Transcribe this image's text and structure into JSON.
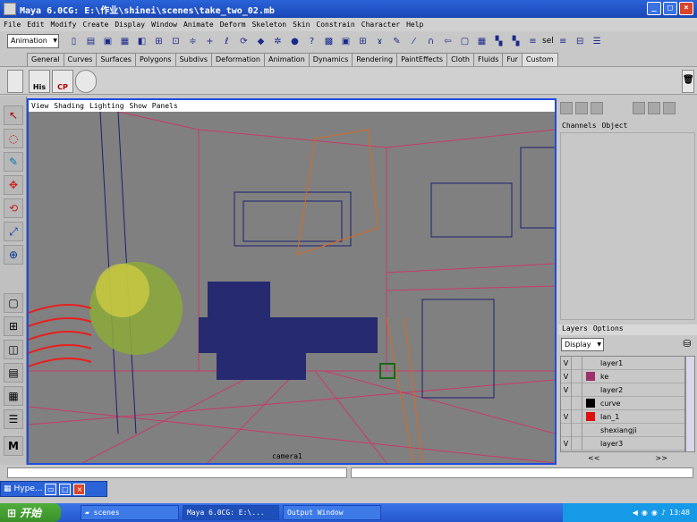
{
  "window": {
    "title": "Maya 6.0CG: E:\\作业\\shinei\\scenes\\take_two_02.mb",
    "controls": [
      "_",
      "□",
      "×"
    ]
  },
  "menubar": [
    "File",
    "Edit",
    "Modify",
    "Create",
    "Display",
    "Window",
    "Animate",
    "Deform",
    "Skeleton",
    "Skin",
    "Constrain",
    "Character",
    "Help"
  ],
  "toolbar": {
    "mode": "Animation",
    "sel_label": "sel"
  },
  "shelf": {
    "tabs": [
      "General",
      "Curves",
      "Surfaces",
      "Polygons",
      "Subdivs",
      "Deformation",
      "Animation",
      "Dynamics",
      "Rendering",
      "PaintEffects",
      "Cloth",
      "Fluids",
      "Fur",
      "Custom"
    ],
    "active": "Custom",
    "buttons": [
      "His",
      "CP"
    ]
  },
  "viewport": {
    "menu": [
      "View",
      "Shading",
      "Lighting",
      "Show",
      "Panels"
    ],
    "camera": "camera1"
  },
  "channel_box": {
    "headers": [
      "Channels",
      "Object"
    ]
  },
  "layers": {
    "headers": [
      "Layers",
      "Options"
    ],
    "display": "Display",
    "items": [
      {
        "v": "V",
        "name": "layer1",
        "color": ""
      },
      {
        "v": "V",
        "name": "ke",
        "color": "#a0306a"
      },
      {
        "v": "V",
        "name": "layer2",
        "color": ""
      },
      {
        "v": "",
        "name": "curve",
        "color": "#000000"
      },
      {
        "v": "V",
        "name": "lan_1",
        "color": "#e01010"
      },
      {
        "v": "",
        "name": "shexiangji",
        "color": ""
      },
      {
        "v": "V",
        "name": "layer3",
        "color": ""
      }
    ],
    "nav": [
      "<<",
      ">>"
    ]
  },
  "minimized_window": {
    "title": "Hype..."
  },
  "taskbar": {
    "start": "开始",
    "items": [
      "scenes",
      "Maya 6.0CG: E:\\...",
      "Output Window"
    ],
    "clock": "13:48"
  }
}
